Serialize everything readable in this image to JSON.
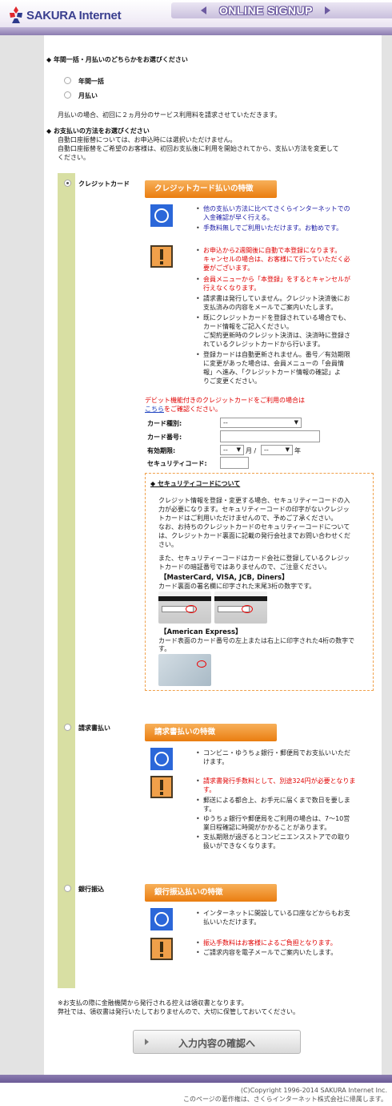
{
  "header": {
    "logo_text": "SAKURA Internet",
    "signup_title": "ONLINE SIGNUP"
  },
  "payment_period": {
    "question": "◆ 年間一括・月払いのどちらかをお選びください",
    "options": [
      "年間一括",
      "月払い"
    ],
    "note": "月払いの場合、初回に２ヵ月分のサービス利用料を請求させていただきます。"
  },
  "payment_method": {
    "question": "◆ お支払いの方法をお選びください",
    "notes": [
      "自動口座振替については、お申込時には選択いただけません。",
      "自動口座振替をご希望のお客様は、初回お支払後に利用を開始されてから、支払い方法を変更して",
      "ください。"
    ]
  },
  "credit": {
    "label": "クレジットカード",
    "header": "クレジットカード払いの特徴",
    "merits": [
      [
        "他の支払い方法に比べてさくらインターネットでの",
        "入金確認が早く行える。"
      ],
      [
        "手数料無しでご利用いただけます。お勧めです。"
      ]
    ],
    "cautions_red": [
      [
        "お申込から2週間後に自動で本登録になります。",
        "キャンセルの場合は、お客様にて行っていただく必",
        "要がございます。"
      ],
      [
        "会員メニューから「本登録」をするとキャンセルが",
        "行えなくなります。"
      ]
    ],
    "cautions": [
      [
        "請求書は発行していません。クレジット決済後にお",
        "支払済みの内容をメールでご案内いたします。"
      ],
      [
        "既にクレジットカードを登録されている場合でも、",
        "カード情報をご記入ください。",
        "ご契約更新時のクレジット決済は、決済時に登録さ",
        "れているクレジットカードから行います。"
      ],
      [
        "登録カードは自動更新されません。番号／有効期限",
        "に変更があった場合は、会員メニューの「会員情",
        "報」へ進み、「クレジットカード情報の確認」よ",
        "りご変更ください。"
      ]
    ],
    "debit_note": "デビット機能付きのクレジットカードをご利用の場合は",
    "debit_link": "こちら",
    "debit_tail": "をご確認ください。",
    "form": {
      "card_type_label": "カード種別:",
      "card_type_value": "--",
      "card_number_label": "カード番号:",
      "expiry_label": "有効期限:",
      "expiry_month": "--",
      "expiry_year": "--",
      "month_unit": "月 /",
      "year_unit": "年",
      "security_label": "セキュリティコード:"
    },
    "security_box": {
      "title": "◆ セキュリティコードについて",
      "lines": [
        "クレジット情報を登録・変更する場合、セキュリティーコードの入",
        "力が必要になります。セキュリティーコードの印字がないクレジッ",
        "トカードはご利用いただけませんので、予めご了承ください。",
        "なお、お持ちのクレジットカードのセキュリティーコードについて",
        "は、クレジットカード裏面に記載の発行会社までお問い合わせくだ",
        "さい。"
      ],
      "lines2": [
        "また、セキュリティーコードはカード会社に登録しているクレジッ",
        "トカードの暗証番号ではありませんので、ご注意ください。"
      ],
      "brands_a": "【MasterCard, VISA, JCB, Diners】",
      "brands_a_desc": "カード裏面の署名欄に印字された末尾3桁の数字です。",
      "brands_b": "【American Express】",
      "brands_b_desc": [
        "カード表面のカード番号の左上または右上に印字された4桁の数字で",
        "す。"
      ]
    }
  },
  "invoice": {
    "label": "請求書払い",
    "header": "請求書払いの特徴",
    "merits": [
      [
        "コンビニ・ゆうちょ銀行・郵便局でお支払いいただ",
        "けます。"
      ]
    ],
    "cautions_red": [
      [
        "請求書発行手数料として、別途324円が必要となりま",
        "す。"
      ]
    ],
    "cautions": [
      [
        "郵送による都合上、お手元に届くまで数日を要しま",
        "す。"
      ],
      [
        "ゆうちょ銀行や郵便局をご利用の場合は、7〜10営",
        "業日程確認に時間がかかることがあります。"
      ],
      [
        "支払期限が過ぎるとコンビニエンスストアでの取り",
        "扱いができなくなります。"
      ]
    ]
  },
  "bank": {
    "label": "銀行振込",
    "header": "銀行振込払いの特徴",
    "merits": [
      [
        "インターネットに開設している口座などからもお支",
        "払いいただけます。"
      ]
    ],
    "cautions_red": [
      [
        "振込手数料はお客様によるご負担となります。"
      ]
    ],
    "cautions": [
      [
        "ご請求内容を電子メールでご案内いたします。"
      ]
    ]
  },
  "receipt_note": [
    "※お支払の際に金融機関から発行される控えは領収書となります。",
    "弊社では、領収書は発行いたしておりませんので、大切に保管しておいてください。"
  ],
  "confirm_button": "入力内容の確認へ",
  "footer": {
    "copyright": "(C)Copyright 1996-2014 SAKURA Internet Inc.",
    "rights": "このページの著作権は、さくらインターネット株式会社に帰属します。"
  }
}
